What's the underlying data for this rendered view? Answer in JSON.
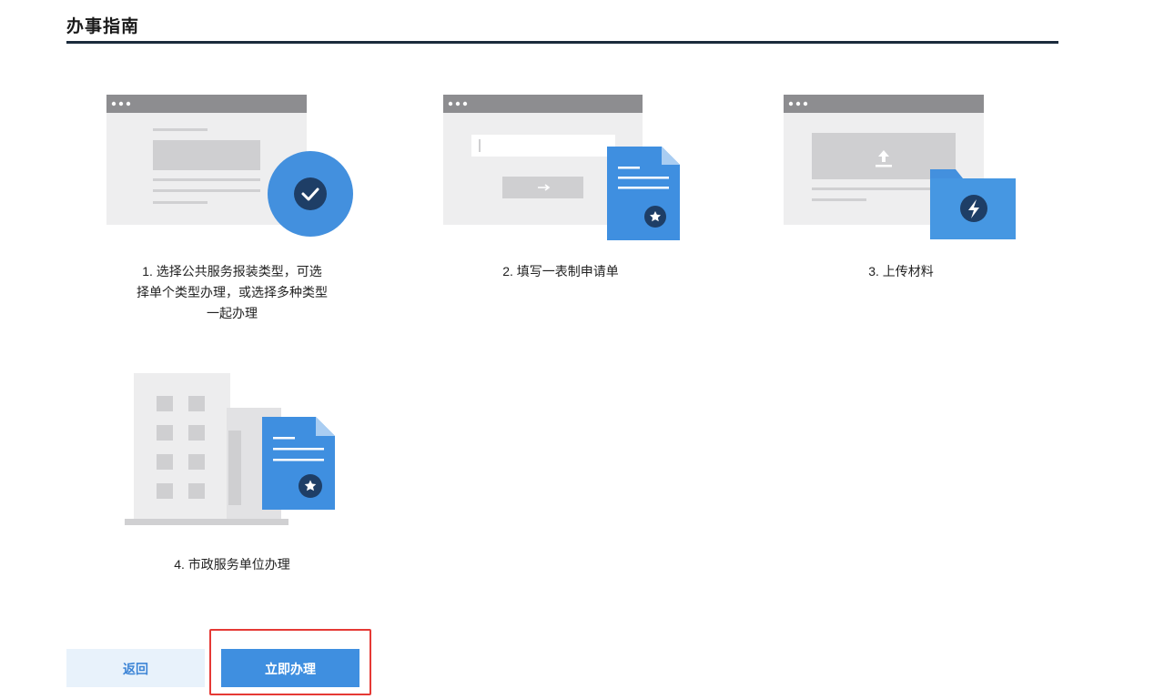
{
  "page": {
    "title": "办事指南"
  },
  "steps": [
    {
      "label_lines": [
        "1.  选择公共服务报装类型，可选",
        "择单个类型办理，或选择多种类型",
        "一起办理"
      ],
      "icon": "browser-check-icon"
    },
    {
      "label_lines": [
        "2. 填写一表制申请单"
      ],
      "icon": "browser-form-document-icon"
    },
    {
      "label_lines": [
        "3. 上传材料"
      ],
      "icon": "browser-upload-folder-icon"
    },
    {
      "label_lines": [
        "4. 市政服务单位办理"
      ],
      "icon": "building-document-icon"
    }
  ],
  "actions": {
    "back_label": "返回",
    "submit_label": "立即办理"
  },
  "colors": {
    "accent_blue": "#3f8fe0",
    "dark_navy": "#1b2b3c",
    "highlight_red": "#e53935",
    "back_bg": "#e8f2fb"
  }
}
